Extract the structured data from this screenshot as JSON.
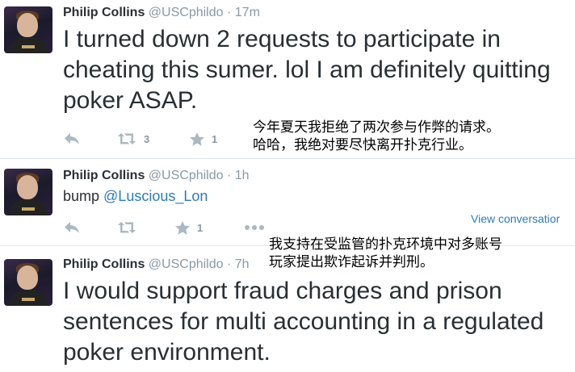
{
  "tweets": [
    {
      "name": "Philip Collins",
      "handle": "@USCphildo",
      "time": "17m",
      "text": "I turned down 2 requests to participate in cheating this sumer. lol I am definitely quitting poker ASAP.",
      "retweets": "3",
      "likes": "1"
    },
    {
      "name": "Philip Collins",
      "handle": "@USCphildo",
      "time": "1h",
      "text_prefix": "bump ",
      "mention": "@Luscious_Lon",
      "likes": "1",
      "view_conversation": "View conversatior"
    },
    {
      "name": "Philip Collins",
      "handle": "@USCphildo",
      "time": "7h",
      "text": "I would support fraud charges and prison sentences for multi accounting in a regulated poker environment."
    }
  ],
  "overlays": {
    "caption1_line1": "今年夏天我拒绝了两次参与作弊的请求。",
    "caption1_line2": "哈哈，我绝对要尽快离开扑克行业。",
    "caption2_line1": "我支持在受监管的扑克环境中对多账号",
    "caption2_line2": "玩家提出欺诈起诉并判刑。"
  },
  "colors": {
    "name": "#292f33",
    "meta": "#8899a6",
    "link": "#2b7bb9",
    "separator": "#e1e8ed"
  },
  "icons": [
    "reply-icon",
    "retweet-icon",
    "favorite-icon",
    "more-icon"
  ]
}
